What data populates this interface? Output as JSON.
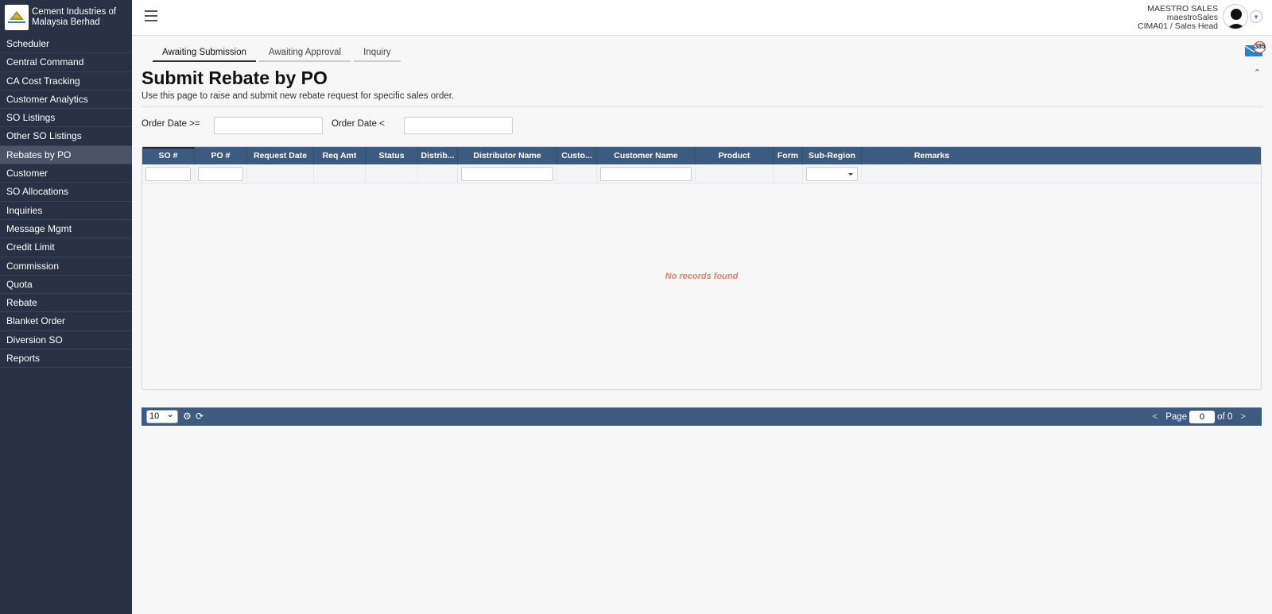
{
  "brand": {
    "name": "Cement Industries of Malaysia Berhad"
  },
  "sidebar": {
    "items": [
      {
        "label": "Scheduler"
      },
      {
        "label": "Central Command"
      },
      {
        "label": "CA Cost Tracking"
      },
      {
        "label": "Customer Analytics"
      },
      {
        "label": "SO Listings"
      },
      {
        "label": "Other SO Listings"
      },
      {
        "label": "Rebates by PO"
      },
      {
        "label": "Customer"
      },
      {
        "label": "SO Allocations"
      },
      {
        "label": "Inquiries"
      },
      {
        "label": "Message Mgmt"
      },
      {
        "label": "Credit Limit"
      },
      {
        "label": "Commission"
      },
      {
        "label": "Quota"
      },
      {
        "label": "Rebate"
      },
      {
        "label": "Blanket Order"
      },
      {
        "label": "Diversion SO"
      },
      {
        "label": "Reports"
      }
    ],
    "active": "Rebates by PO"
  },
  "user": {
    "display_name": "MAESTRO SALES",
    "username": "maestroSales",
    "role": "CIMA01 / Sales Head"
  },
  "notifications": {
    "count": "385"
  },
  "tabs": [
    {
      "label": "Awaiting Submission"
    },
    {
      "label": "Awaiting Approval"
    },
    {
      "label": "Inquiry"
    }
  ],
  "page": {
    "title": "Submit Rebate by PO",
    "description": "Use this page to raise and submit new rebate request for specific sales order."
  },
  "filters": {
    "order_date_from_label": "Order Date >=",
    "order_date_to_label": "Order Date <",
    "order_date_from_value": "",
    "order_date_to_value": ""
  },
  "grid": {
    "columns": [
      {
        "label": "SO #"
      },
      {
        "label": "PO #"
      },
      {
        "label": "Request Date"
      },
      {
        "label": "Req Amt"
      },
      {
        "label": "Status"
      },
      {
        "label": "Distrib..."
      },
      {
        "label": "Distributor Name"
      },
      {
        "label": "Custo..."
      },
      {
        "label": "Customer Name"
      },
      {
        "label": "Product"
      },
      {
        "label": "Form"
      },
      {
        "label": "Sub-Region"
      },
      {
        "label": "Remarks"
      }
    ],
    "empty_message": "No records found"
  },
  "pager": {
    "page_size": "10",
    "page_label": "Page",
    "page_value": "0",
    "of_label": "of 0",
    "prev": "<",
    "next": ">"
  },
  "colors": {
    "sidebar_bg": "#283244",
    "grid_header_bg": "#3d5a80",
    "empty_text": "#e07b6d"
  }
}
